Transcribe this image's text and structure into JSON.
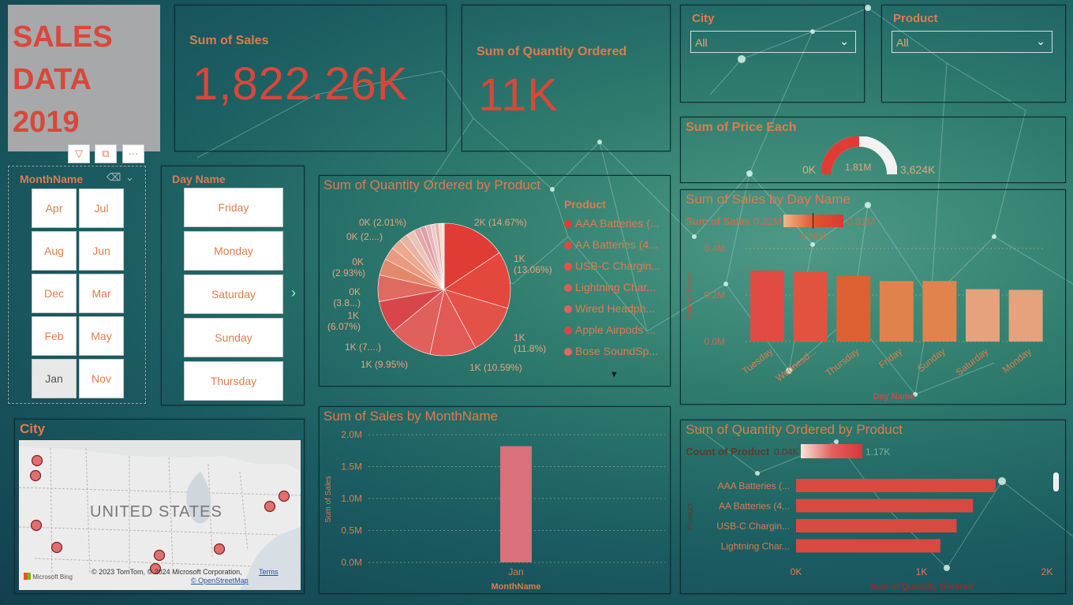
{
  "title": {
    "line1": "SALES",
    "line2": "DATA",
    "line3": "2019"
  },
  "kpis": [
    {
      "label": "Sum of Sales",
      "value": "1,822.26K"
    },
    {
      "label": "Sum of Quantity Ordered",
      "value": "11K"
    }
  ],
  "city_slicer": {
    "title": "City",
    "value": "All"
  },
  "product_slicer": {
    "title": "Product",
    "value": "All"
  },
  "month_slicer": {
    "title": "MonthName",
    "months": [
      "Apr",
      "Jul",
      "Aug",
      "Jun",
      "Dec",
      "Mar",
      "Feb",
      "May",
      "Jan",
      "Nov"
    ],
    "selected": "Jan"
  },
  "day_slicer": {
    "title": "Day Name",
    "days": [
      "Friday",
      "Monday",
      "Saturday",
      "Sunday",
      "Thursday"
    ]
  },
  "gauge": {
    "title": "Sum of Price Each",
    "min": "0K",
    "value": "1.81M",
    "max": "3,624K",
    "fraction": 0.5
  },
  "map": {
    "title": "City",
    "country": "UNITED STATES",
    "credit": "© 2023 TomTom, © 2024 Microsoft Corporation,",
    "terms": "Terms",
    "osm": "© OpenStreetMap",
    "bing": "Microsoft Bing"
  },
  "colors": {
    "accent": "#e07b4c",
    "kpi": "#d9473a",
    "bar": "#d84a40"
  },
  "chart_data": [
    {
      "type": "pie",
      "title": "Sum of Quantity Ordered by Product",
      "legend_title": "Product",
      "legend": [
        "AAA Batteries (...",
        "AA Batteries (4...",
        "USB-C Chargin...",
        "Lightning Char...",
        "Wired Headph...",
        "Apple Airpods ...",
        "Bose SoundSp..."
      ],
      "labels": [
        "2K (14.67%)",
        "1K (13.06%)",
        "1K (11.8%)",
        "1K (10.59%)",
        "1K (9.95%)",
        "1K (7....)",
        "1K (6.07%)",
        "0K (3.8...)",
        "0K (2.93%)",
        "0K (2....)",
        "0K (2.01%)"
      ],
      "values": [
        14.67,
        13.06,
        11.8,
        10.59,
        9.95,
        7.5,
        6.07,
        3.8,
        2.93,
        2.5,
        2.01,
        1.8,
        1.5,
        1.3,
        1.2,
        1.0,
        0.9,
        0.7,
        0.5
      ],
      "colors": [
        "#e03c35",
        "#e3473d",
        "#e35249",
        "#e15a55",
        "#e0605c",
        "#d8464c",
        "#de6a62",
        "#e3896b",
        "#ea9a80",
        "#eba98f",
        "#e8b3a2",
        "#e9c4b8",
        "#e3a9a9",
        "#dca1a5",
        "#e5b6b9",
        "#edc9c9",
        "#e7b2a8",
        "#f1d6cf",
        "#f4e0da"
      ]
    },
    {
      "type": "bar",
      "title": "Sum of Sales by Day Name",
      "legend_title": "Sum of Sales",
      "legend_min": "0.22M",
      "legend_max": "0.31M",
      "legend_mid": "0.26M",
      "categories": [
        "Tuesday",
        "Wednesd...",
        "Thursday",
        "Friday",
        "Sunday",
        "Saturday",
        "Monday"
      ],
      "values": [
        0.305,
        0.3,
        0.282,
        0.26,
        0.26,
        0.225,
        0.222
      ],
      "colors": [
        "#e14b43",
        "#e1533f",
        "#de6133",
        "#e0824c",
        "#e0834d",
        "#e6a27c",
        "#e6a27c"
      ],
      "yticks": [
        "0.4M",
        "0.2M",
        "0.0M"
      ],
      "ylim": [
        0,
        0.4
      ],
      "xlabel": "Day Name",
      "ylabel": "Sum of Sales"
    },
    {
      "type": "bar",
      "title": "Sum of Sales by MonthName",
      "categories": [
        "Jan"
      ],
      "values": [
        1.82
      ],
      "yticks": [
        "2.0M",
        "1.5M",
        "1.0M",
        "0.5M",
        "0.0M"
      ],
      "ylim": [
        0,
        2
      ],
      "xlabel": "MonthName",
      "ylabel": "Sum of Sales"
    },
    {
      "type": "bar",
      "orientation": "horizontal",
      "title": "Sum of Quantity Ordered by Product",
      "legend_title": "Count of Product",
      "legend_min": "0.04K",
      "legend_max": "1.17K",
      "categories": [
        "AAA Batteries (...",
        "AA Batteries (4...",
        "USB-C Chargin...",
        "Lightning Char..."
      ],
      "values": [
        1.59,
        1.41,
        1.28,
        1.15
      ],
      "xticks": [
        "0K",
        "1K",
        "2K"
      ],
      "xlim": [
        0,
        2
      ],
      "xlabel": "Sum of Quantity Ordered",
      "ylabel": "Product"
    }
  ]
}
